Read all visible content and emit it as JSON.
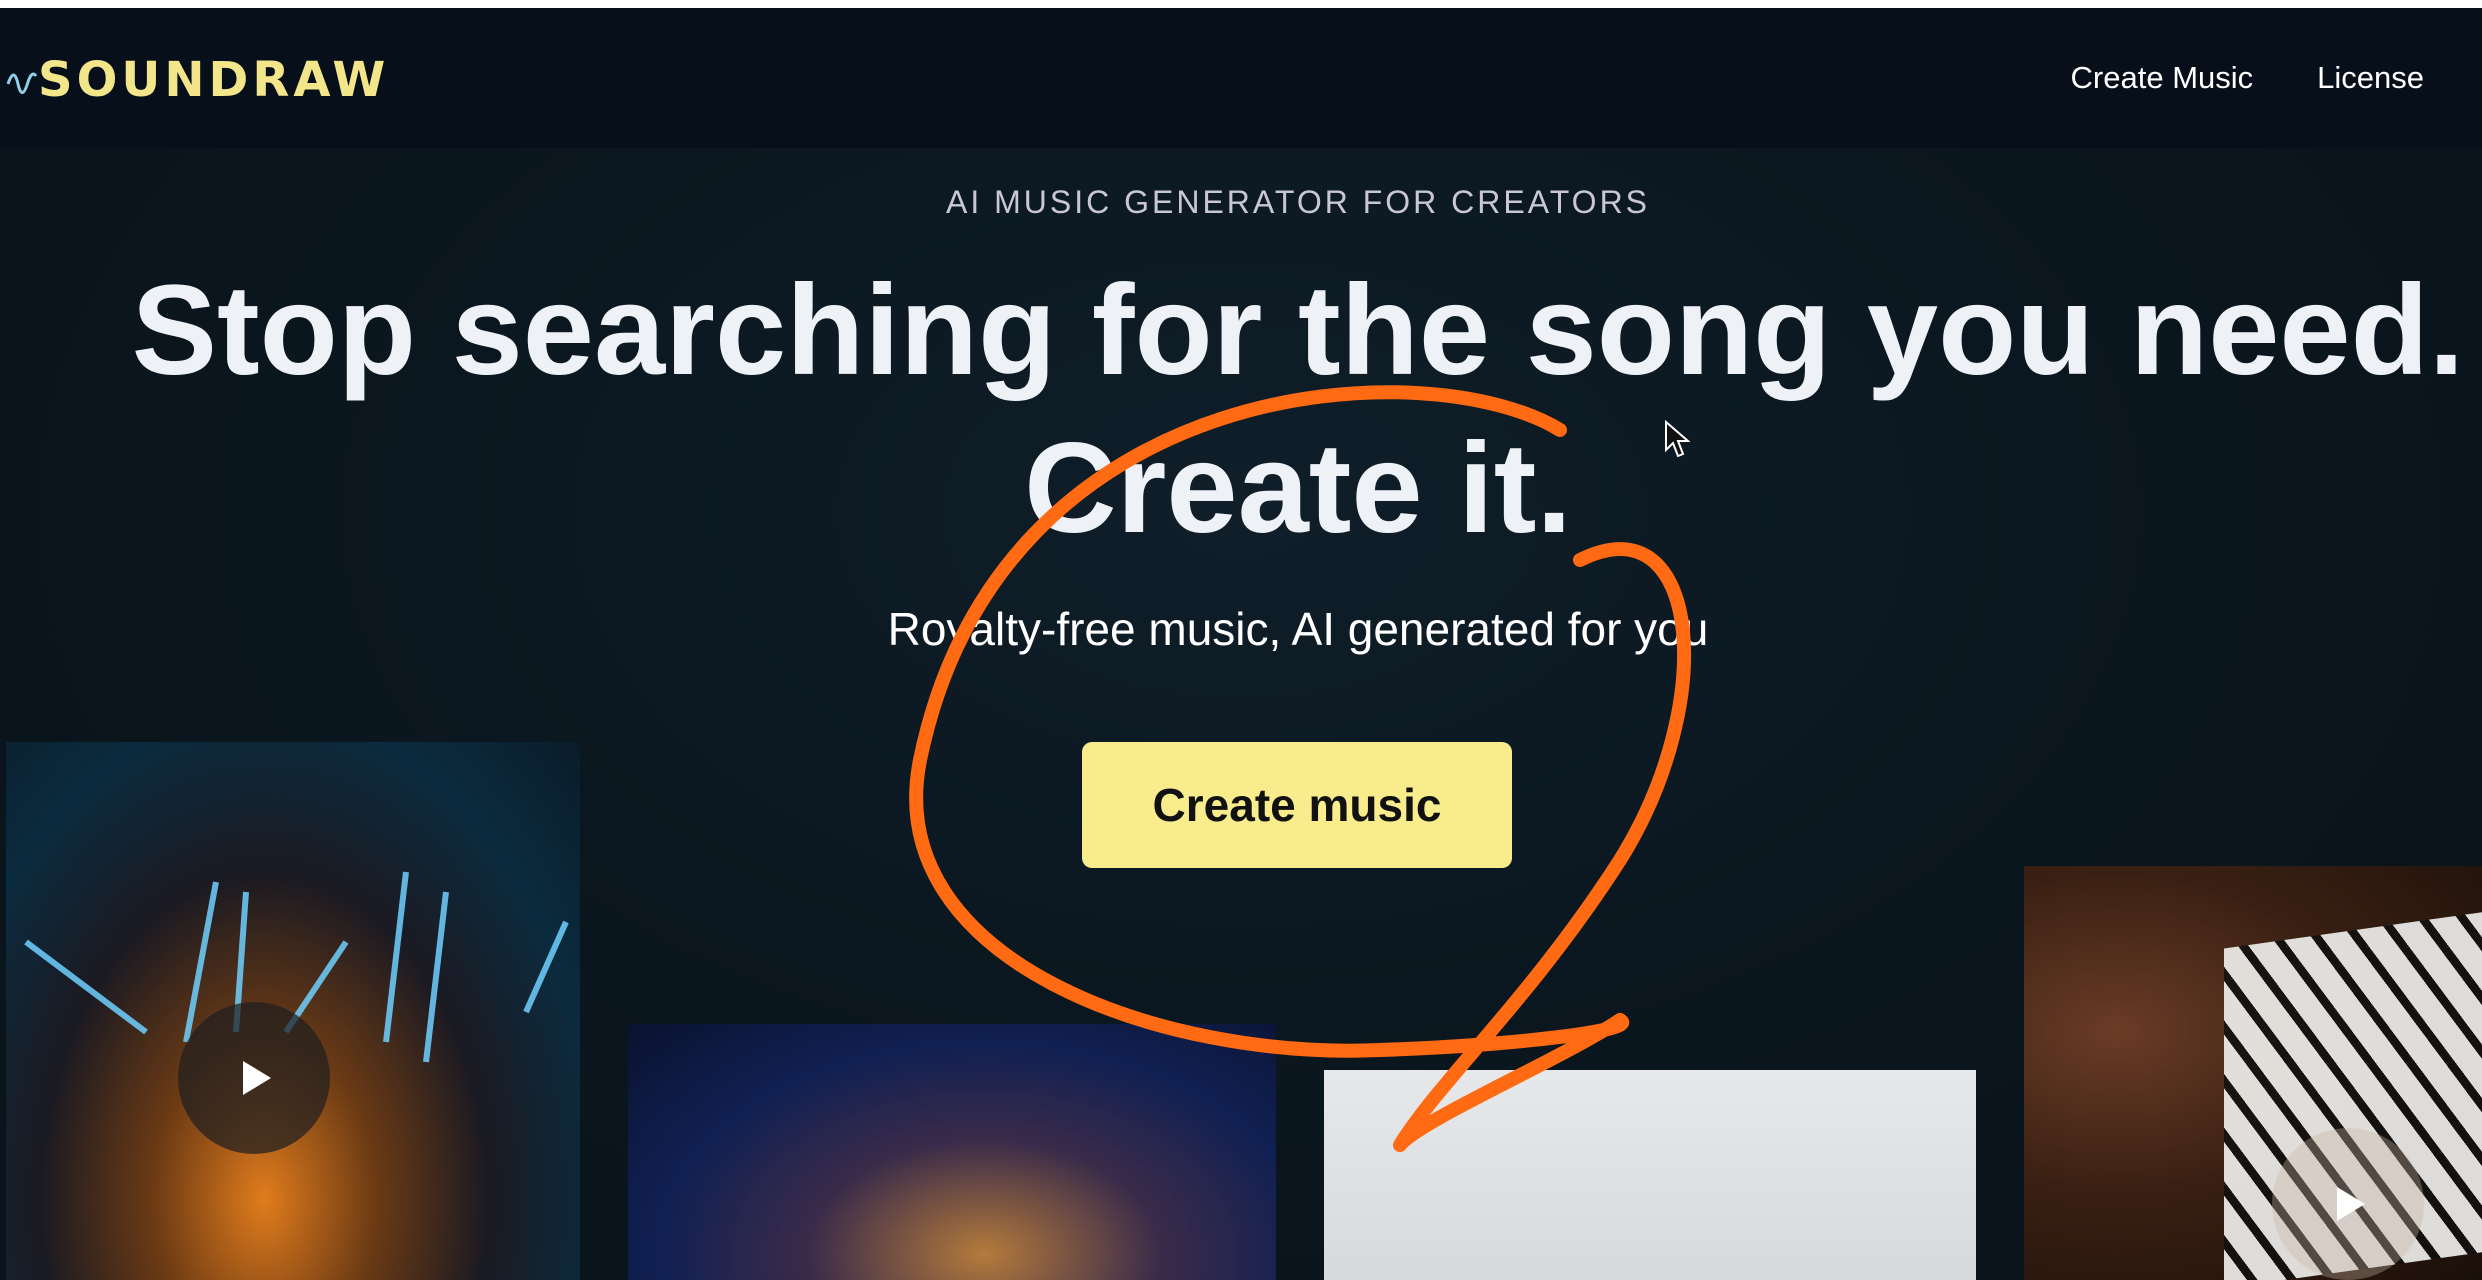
{
  "brand": {
    "name": "SOUNDRAW",
    "color": "#f3e58a"
  },
  "nav": {
    "links": [
      "Create Music",
      "License"
    ]
  },
  "hero": {
    "eyebrow": "AI MUSIC GENERATOR FOR CREATORS",
    "headline_line1": "Stop searching for the song you need.",
    "headline_line2": "Create it.",
    "subtitle": "Royalty-free music, AI generated for you",
    "cta_label": "Create music",
    "cta_color": "#f8ec8c"
  },
  "annotation": {
    "type": "hand-drawn circle around CTA",
    "color": "#ff6a13"
  },
  "colors": {
    "background": "#0b1720",
    "navbar": "#07101a",
    "text": "#eef1f6"
  }
}
